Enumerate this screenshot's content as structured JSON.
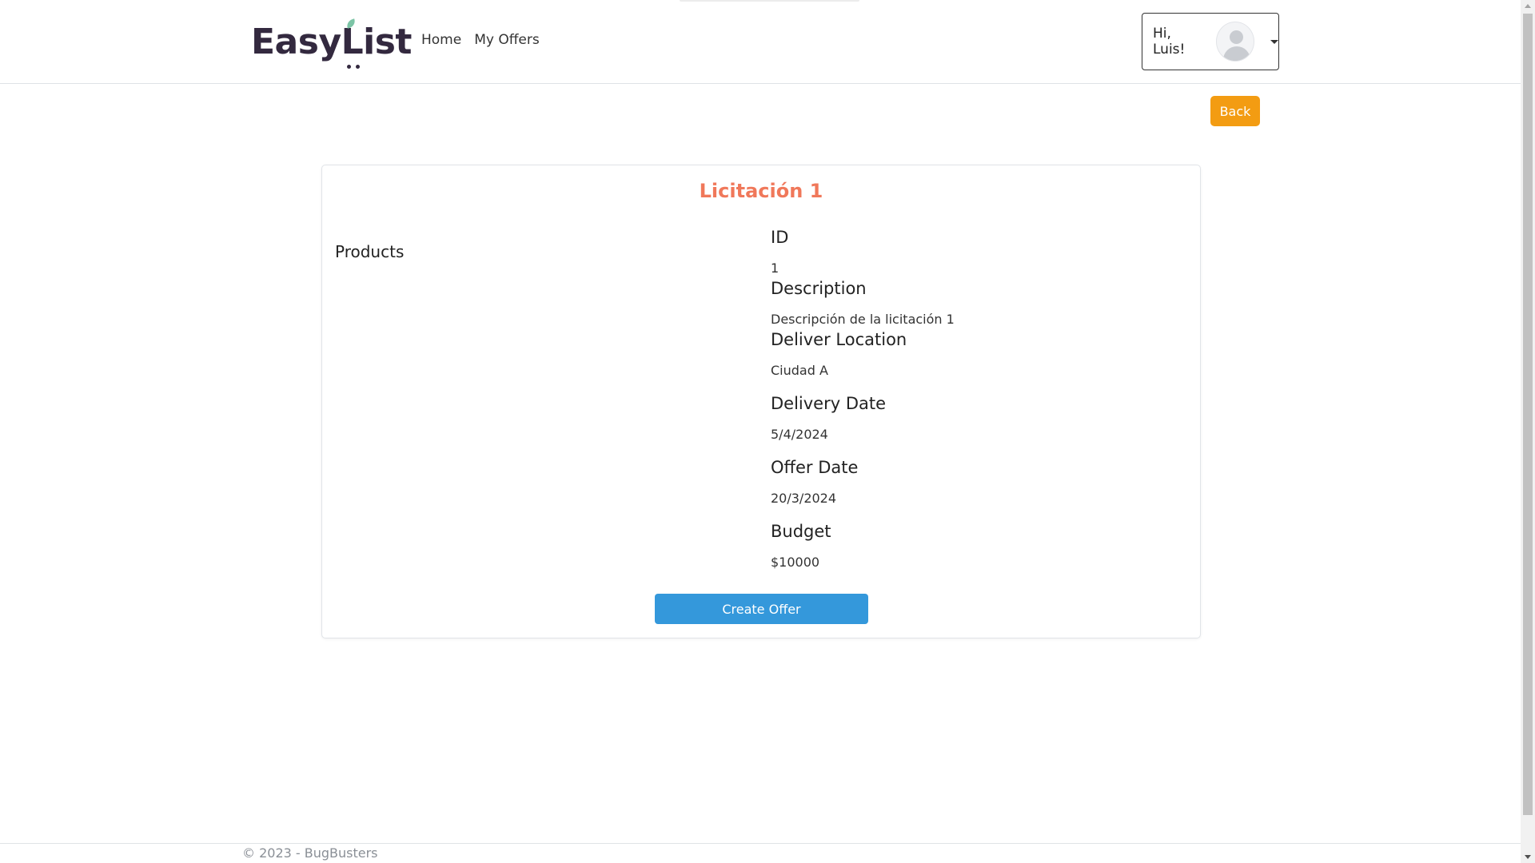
{
  "header": {
    "brand": {
      "part1": "Easy",
      "part2": "List"
    },
    "nav": [
      {
        "label": "Home"
      },
      {
        "label": "My Offers"
      }
    ],
    "user": {
      "greeting": "Hi, Luis!"
    }
  },
  "actions": {
    "back_label": "Back"
  },
  "tender": {
    "title": "Licitación 1",
    "products_label": "Products",
    "fields": [
      {
        "label": "ID",
        "value": "1"
      },
      {
        "label": "Description",
        "value": "Descripción de la licitación 1"
      },
      {
        "label": "Deliver Location",
        "value": "Ciudad A"
      },
      {
        "label": "Delivery Date",
        "value": "5/4/2024"
      },
      {
        "label": "Offer Date",
        "value": "20/3/2024"
      },
      {
        "label": "Budget",
        "value": "$10000"
      }
    ],
    "create_offer_label": "Create Offer"
  },
  "footer": {
    "text": "© 2023 - BugBusters"
  },
  "colors": {
    "brand": "#33293f",
    "title": "#f0785a",
    "back_button": "#f39c12",
    "primary_button": "#3498db"
  }
}
